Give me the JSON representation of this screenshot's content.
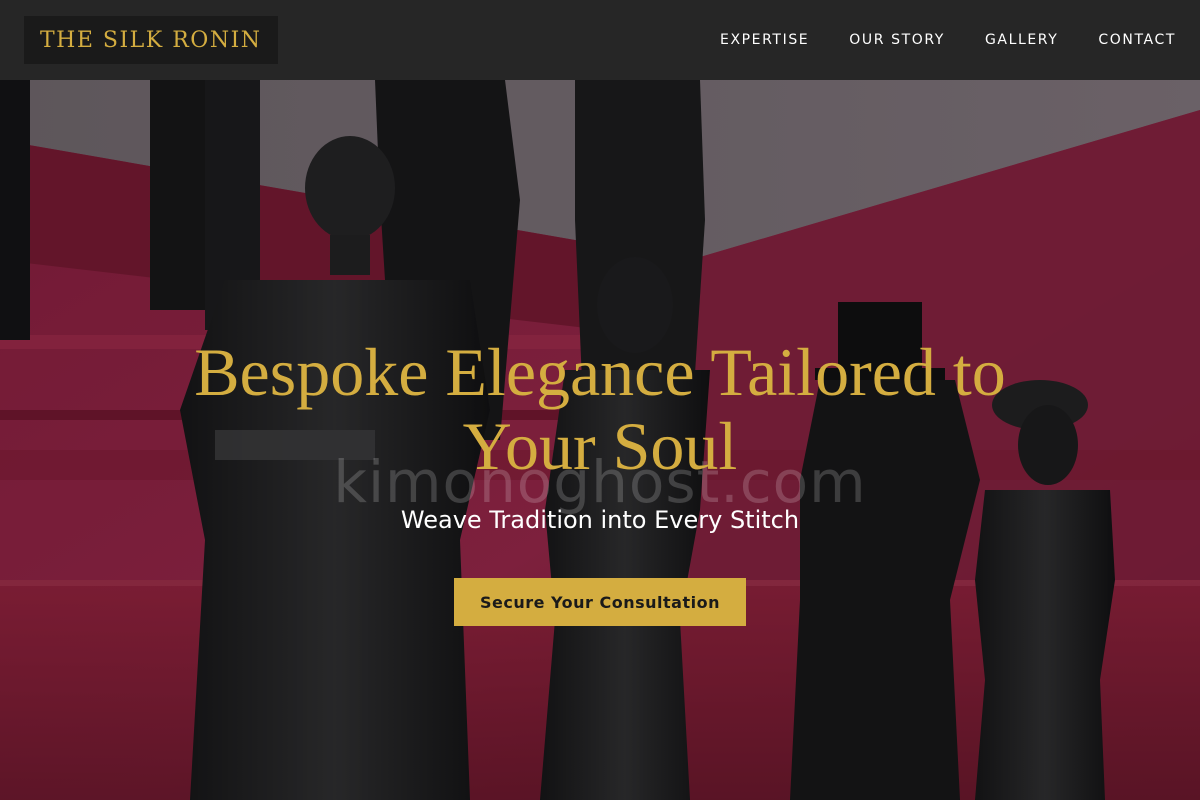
{
  "header": {
    "logo_text": "THE SILK RONIN",
    "nav": [
      {
        "label": "EXPERTISE"
      },
      {
        "label": "OUR STORY"
      },
      {
        "label": "GALLERY"
      },
      {
        "label": "CONTACT"
      }
    ]
  },
  "hero": {
    "title": "Bespoke Elegance Tailored to Your Soul",
    "subtitle": "Weave Tradition into Every Stitch",
    "cta_label": "Secure Your Consultation",
    "watermark": "kimonoghost.com"
  },
  "colors": {
    "header_bg": "#262626",
    "logo_bg": "#1a1a1a",
    "gold_accent": "#d4ad40",
    "hero_wall_magenta": "#b0284f",
    "nav_text": "#ffffff"
  }
}
